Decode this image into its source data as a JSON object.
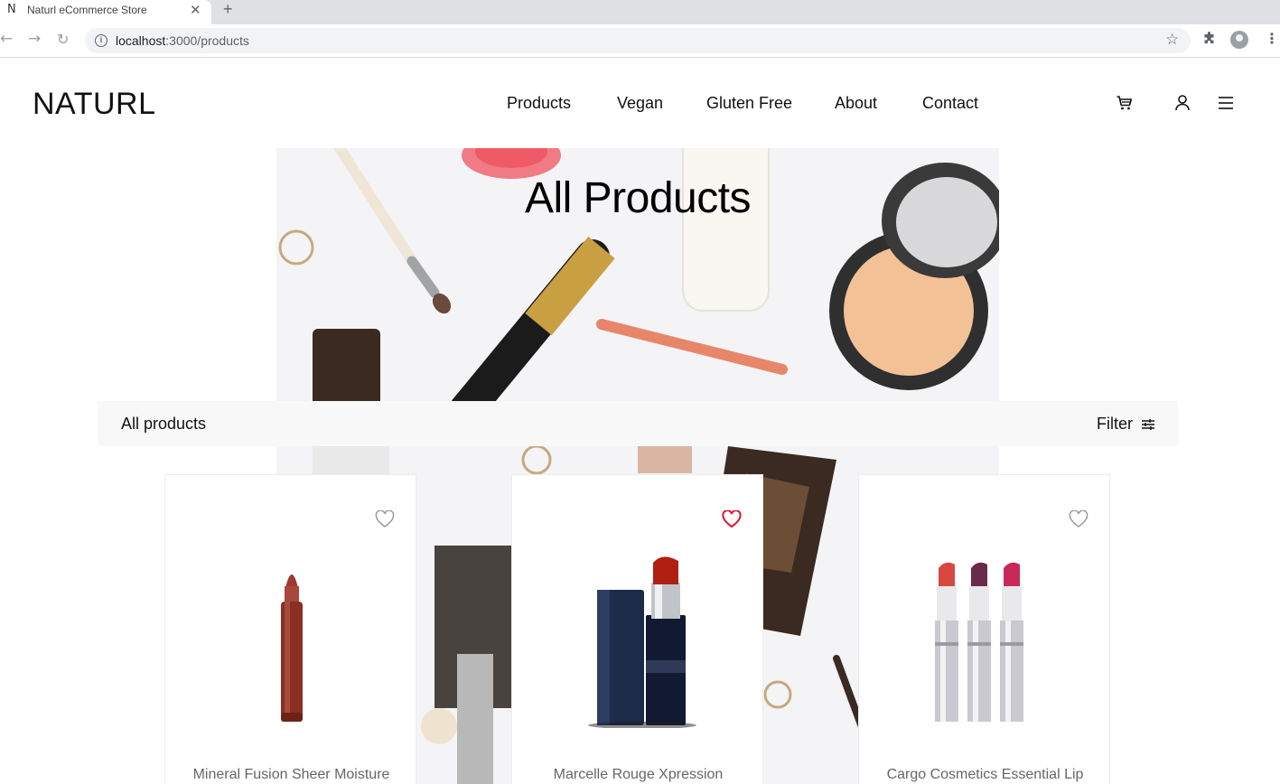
{
  "browser": {
    "tab_title": "Naturl eCommerce Store",
    "tab_favicon": "N",
    "url_host": "localhost",
    "url_path": ":3000/products"
  },
  "site": {
    "logo": "NATURL",
    "nav": [
      "Products",
      "Vegan",
      "Gluten Free",
      "About",
      "Contact"
    ],
    "icons": [
      "cart-icon",
      "user-icon",
      "hamburger-menu-icon"
    ]
  },
  "hero": {
    "title": "All Products"
  },
  "filterbar": {
    "label": "All products",
    "filter_label": "Filter"
  },
  "products": [
    {
      "name": "Mineral Fusion Sheer Moisture",
      "favorited": false
    },
    {
      "name": "Marcelle Rouge Xpression",
      "favorited": true
    },
    {
      "name": "Cargo Cosmetics Essential Lip",
      "favorited": false
    }
  ],
  "colors": {
    "accent_heart": "#e0112b",
    "heart_outline": "#9a9a9a",
    "filterbar_bg": "#f8f8f8"
  }
}
